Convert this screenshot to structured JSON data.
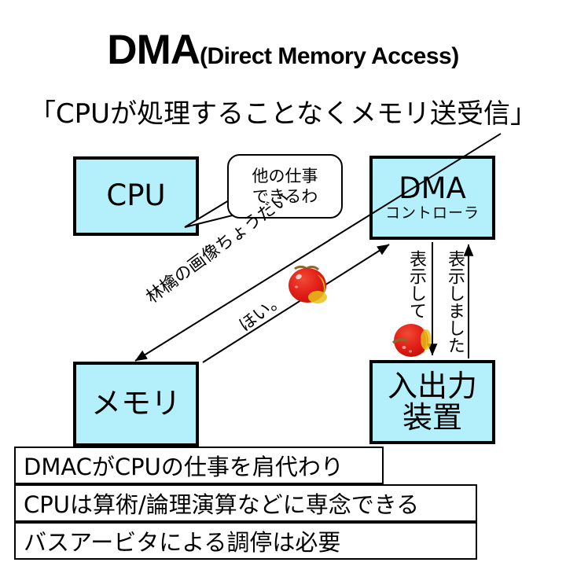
{
  "title": {
    "main": "DMA",
    "sub": "(Direct Memory Access)",
    "subtitle": "「CPUが処理することなくメモリ送受信」"
  },
  "nodes": {
    "cpu": {
      "label": "CPU"
    },
    "dma": {
      "label": "DMA",
      "sublabel": "コントローラ"
    },
    "memory": {
      "label": "メモリ"
    },
    "io": {
      "line1": "入出力",
      "line2": "装置"
    }
  },
  "bubble": {
    "line1": "他の仕事",
    "line2": "できるわ"
  },
  "arrows": {
    "request": "林檎の画像ちょうだい",
    "reply": "ほい。",
    "display": "表示して",
    "displayed": "表示しました"
  },
  "bullets": [
    "DMACがCPUの仕事を肩代わり",
    "CPUは算術/論理演算などに専念できる",
    "バスアービタによる調停は必要"
  ],
  "colors": {
    "box_fill": "#b3f0fb",
    "box_border": "#000000",
    "apple_red": "#e32119",
    "apple_yellow": "#e8c11a",
    "background": "#ffffff"
  }
}
